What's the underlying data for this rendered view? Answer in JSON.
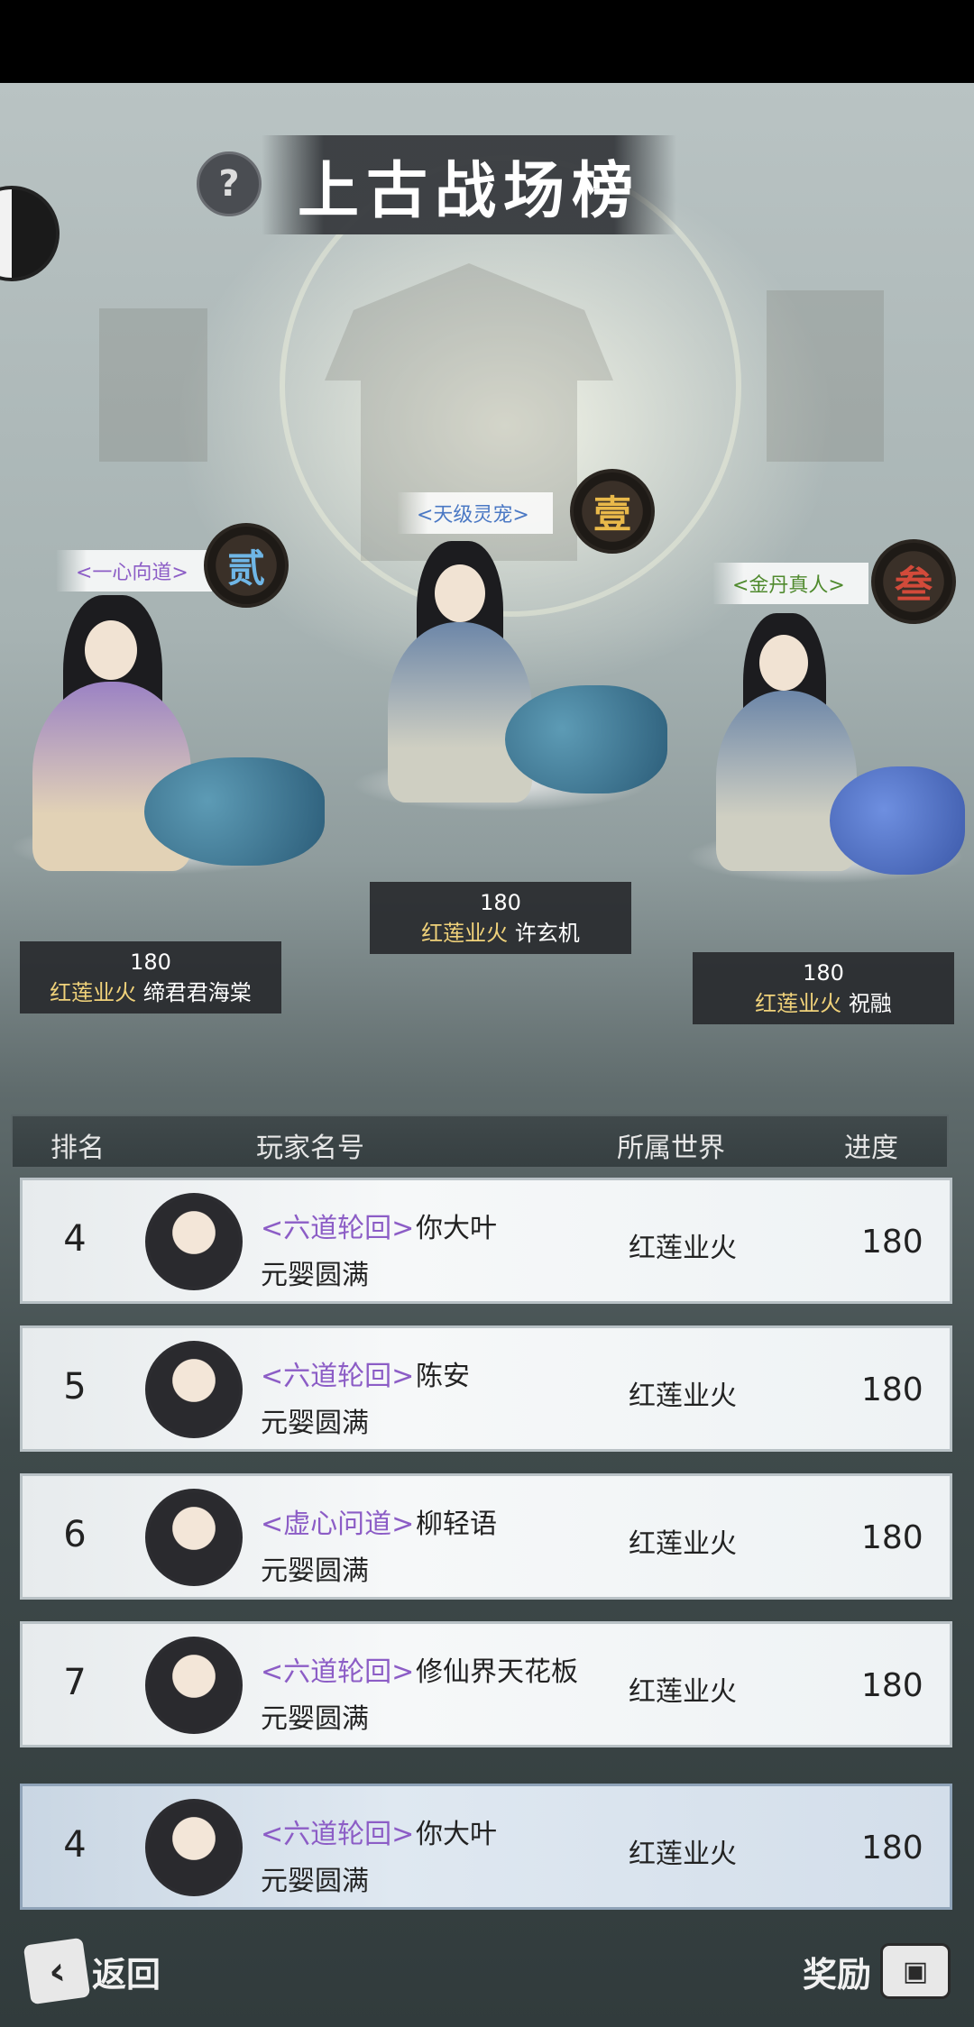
{
  "title": "上古战场榜",
  "help_icon": "?",
  "podium": [
    {
      "place_glyph": "壹",
      "sect": "<天级灵宠>",
      "sect_color": "#4a78c4",
      "progress": "180",
      "world": "红莲业火",
      "name": "许玄机"
    },
    {
      "place_glyph": "贰",
      "sect": "<一心向道>",
      "sect_color": "#8c5dc6",
      "progress": "180",
      "world": "红莲业火",
      "name": "缔君君海棠"
    },
    {
      "place_glyph": "叁",
      "sect": "<金丹真人>",
      "sect_color": "#4f8a2d",
      "progress": "180",
      "world": "红莲业火",
      "name": "祝融"
    }
  ],
  "table": {
    "headers": [
      "排名",
      "玩家名号",
      "所属世界",
      "进度"
    ],
    "rows": [
      {
        "rank": "4",
        "sect": "<六道轮回>",
        "name": "你大叶",
        "realm": "元婴圆满",
        "world": "红莲业火",
        "progress": "180"
      },
      {
        "rank": "5",
        "sect": "<六道轮回>",
        "name": "陈安",
        "realm": "元婴圆满",
        "world": "红莲业火",
        "progress": "180"
      },
      {
        "rank": "6",
        "sect": "<虚心问道>",
        "name": "柳轻语",
        "realm": "元婴圆满",
        "world": "红莲业火",
        "progress": "180"
      },
      {
        "rank": "7",
        "sect": "<六道轮回>",
        "name": "修仙界天花板",
        "realm": "元婴圆满",
        "world": "红莲业火",
        "progress": "180"
      }
    ],
    "me": {
      "rank": "4",
      "sect": "<六道轮回>",
      "name": "你大叶",
      "realm": "元婴圆满",
      "world": "红莲业火",
      "progress": "180"
    }
  },
  "footer": {
    "back_label": "返回",
    "reward_label": "奖励"
  }
}
